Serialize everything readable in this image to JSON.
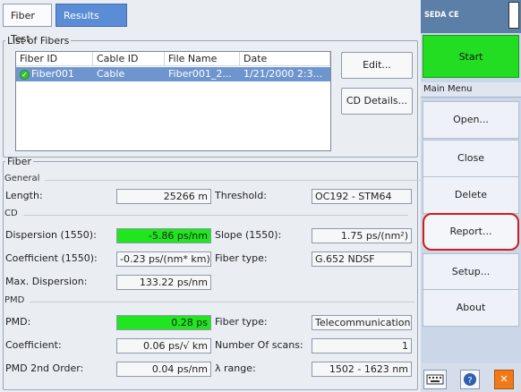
{
  "tabs": {
    "fiber_test": "Fiber Test",
    "results": "Results"
  },
  "list": {
    "legend": "List of Fibers",
    "columns": [
      "Fiber ID",
      "Cable ID",
      "File Name",
      "Date"
    ],
    "rows": [
      {
        "fiber_id": "Fiber001",
        "cable_id": "Cable",
        "file_name": "Fiber001_2...",
        "date": "1/21/2000 2:3..."
      }
    ],
    "edit_label": "Edit...",
    "cd_details_label": "CD Details..."
  },
  "fiber": {
    "legend": "Fiber",
    "general": {
      "heading": "General",
      "length_label": "Length:",
      "length_value": "25266 m",
      "threshold_label": "Threshold:",
      "threshold_value": "OC192 - STM64"
    },
    "cd": {
      "heading": "CD",
      "dispersion_label": "Dispersion (1550):",
      "dispersion_value": "-5.86 ps/nm",
      "slope_label": "Slope (1550):",
      "slope_value": "1.75 ps/(nm²)",
      "coefficient_label": "Coefficient (1550):",
      "coefficient_value": "-0.23 ps/(nm* km)",
      "fiber_type_label": "Fiber type:",
      "fiber_type_value": "G.652 NDSF",
      "max_dispersion_label": "Max. Dispersion:",
      "max_dispersion_value": "133.22 ps/nm"
    },
    "pmd": {
      "heading": "PMD",
      "pmd_label": "PMD:",
      "pmd_value": "0.28 ps",
      "fiber_type_label": "Fiber type:",
      "fiber_type_value": "Telecommunication",
      "coefficient_label": "Coefficient:",
      "coefficient_value": "0.06 ps/√ km",
      "scans_label": "Number Of scans:",
      "scans_value": "1",
      "second_order_label": "PMD 2nd Order:",
      "second_order_value": "0.04 ps/nm",
      "range_label": "λ range:",
      "range_value": "1502 - 1623 nm"
    }
  },
  "sidebar": {
    "title": "SEDA CE",
    "start_label": "Start",
    "menu_heading": "Main Menu",
    "items": [
      "Open...",
      "Close",
      "Delete",
      "Report...",
      "Setup...",
      "About"
    ]
  },
  "colors": {
    "tab_active": "#5b8cd6",
    "highlight_green": "#1fe61f",
    "start_green": "#22dd22",
    "selection": "#6f95cf",
    "report_outline": "#d01c1c"
  }
}
